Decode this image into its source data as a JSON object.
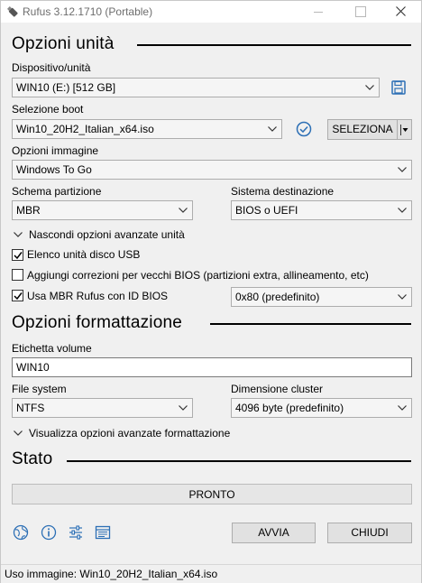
{
  "window": {
    "title": "Rufus 3.12.1710 (Portable)"
  },
  "drive_section": {
    "title": "Opzioni unità",
    "device_label": "Dispositivo/unità",
    "device_value": "WIN10 (E:) [512 GB]",
    "boot_label": "Selezione boot",
    "boot_value": "Win10_20H2_Italian_x64.iso",
    "select_button": "SELEZIONA",
    "image_option_label": "Opzioni immagine",
    "image_option_value": "Windows To Go",
    "partition_label": "Schema partizione",
    "partition_value": "MBR",
    "target_label": "Sistema destinazione",
    "target_value": "BIOS o UEFI",
    "advanced_toggle": "Nascondi opzioni avanzate unità",
    "list_usb_label": "Elenco unità disco USB",
    "list_usb_checked": true,
    "old_bios_label": "Aggiungi correzioni per vecchi BIOS (partizioni extra, allineamento, etc)",
    "old_bios_checked": false,
    "rufus_mbr_label": "Usa MBR Rufus con ID BIOS",
    "rufus_mbr_checked": true,
    "bios_id_value": "0x80 (predefinito)"
  },
  "format_section": {
    "title": "Opzioni formattazione",
    "volume_label": "Etichetta volume",
    "volume_value": "WIN10",
    "fs_label": "File system",
    "fs_value": "NTFS",
    "cluster_label": "Dimensione cluster",
    "cluster_value": "4096 byte (predefinito)",
    "advanced_toggle": "Visualizza opzioni avanzate formattazione"
  },
  "status_section": {
    "title": "Stato",
    "progress_text": "PRONTO",
    "progress_fraction": 0
  },
  "actions": {
    "start_button": "AVVIA",
    "close_button": "CHIUDI"
  },
  "statusbar": {
    "text": "Uso immagine: Win10_20H2_Italian_x64.iso"
  },
  "colors": {
    "accent_blue": "#2c6fb5",
    "window_bg": "#f0f0f0"
  },
  "icons": [
    "usb-drive-icon",
    "save-icon",
    "verify-check-icon",
    "split-dropdown-icon",
    "globe-icon",
    "info-icon",
    "settings-sliders-icon",
    "log-icon"
  ]
}
